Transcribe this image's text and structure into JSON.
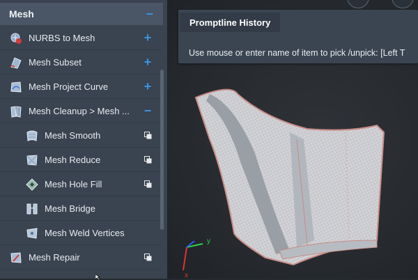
{
  "panel": {
    "title": "Mesh",
    "items": [
      {
        "label": "NURBS to Mesh",
        "icon": "nurbs-to-mesh-icon",
        "action": "plus"
      },
      {
        "label": "Mesh Subset",
        "icon": "mesh-subset-icon",
        "action": "plus"
      },
      {
        "label": "Mesh Project Curve",
        "icon": "mesh-project-curve-icon",
        "action": "plus"
      },
      {
        "label": "Mesh Cleanup > Mesh ...",
        "icon": "mesh-cleanup-icon",
        "action": "minus"
      },
      {
        "label": "Mesh Smooth",
        "icon": "mesh-smooth-icon",
        "action": "window"
      },
      {
        "label": "Mesh Reduce",
        "icon": "mesh-reduce-icon",
        "action": "window"
      },
      {
        "label": "Mesh Hole Fill",
        "icon": "mesh-hole-fill-icon",
        "action": "window"
      },
      {
        "label": "Mesh Bridge",
        "icon": "mesh-bridge-icon",
        "action": ""
      },
      {
        "label": "Mesh Weld Vertices",
        "icon": "mesh-weld-vertices-icon",
        "action": ""
      },
      {
        "label": "Mesh Repair",
        "icon": "mesh-repair-icon",
        "action": "window"
      }
    ]
  },
  "history": {
    "tab_label": "Promptline History",
    "message": "Use mouse or enter name of item to pick /unpick: [Left T"
  },
  "axes": {
    "x": "x",
    "y": "y",
    "z": "z"
  },
  "colors": {
    "accent": "#3b94e0",
    "panel_bg": "#3a4350",
    "mesh_edge": "#c98b86",
    "axis_x": "#e0342c",
    "axis_y": "#2fd14a",
    "axis_z": "#2e5bff"
  }
}
